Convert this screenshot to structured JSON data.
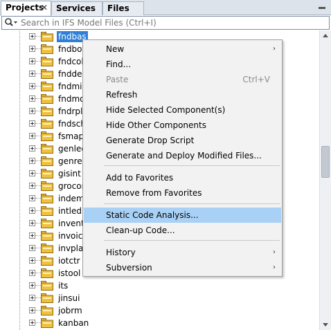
{
  "tabs": [
    {
      "label": "Projects",
      "active": true,
      "close": "✕"
    },
    {
      "label": "Services",
      "active": false
    },
    {
      "label": "Files",
      "active": false
    }
  ],
  "search": {
    "placeholder": "Search in IFS Model Files (Ctrl+I)"
  },
  "tree": {
    "items": [
      "fndbas",
      "fndbot",
      "fndcob",
      "fnddev",
      "fndmig",
      "fndmo",
      "fndrpl",
      "fndsch",
      "fsmapp",
      "genled",
      "genres",
      "gisint",
      "grocon",
      "indemr",
      "intled",
      "invent",
      "invoic",
      "invpla",
      "iotctr",
      "istool",
      "its",
      "jinsui",
      "jobrm",
      "kanban"
    ],
    "selected": "fndbas"
  },
  "context_menu": {
    "items": [
      {
        "label": "New",
        "submenu": true
      },
      {
        "label": "Find..."
      },
      {
        "label": "Paste",
        "disabled": true,
        "shortcut": "Ctrl+V"
      },
      {
        "label": "Refresh"
      },
      {
        "label": "Hide Selected Component(s)"
      },
      {
        "label": "Hide Other Components"
      },
      {
        "label": "Generate Drop Script"
      },
      {
        "label": "Generate and Deploy Modified Files..."
      },
      {
        "label": "Add to Favorites"
      },
      {
        "label": "Remove from Favorites"
      },
      {
        "label": "Static Code Analysis...",
        "highlighted": true
      },
      {
        "label": "Clean-up Code..."
      },
      {
        "label": "History",
        "submenu": true
      },
      {
        "label": "Subversion",
        "submenu": true
      }
    ],
    "submenu_glyph": "›"
  },
  "colors": {
    "selection": "#2f7fd5",
    "menu_highlight": "#a9d1f5",
    "folder": "#f0c040"
  }
}
